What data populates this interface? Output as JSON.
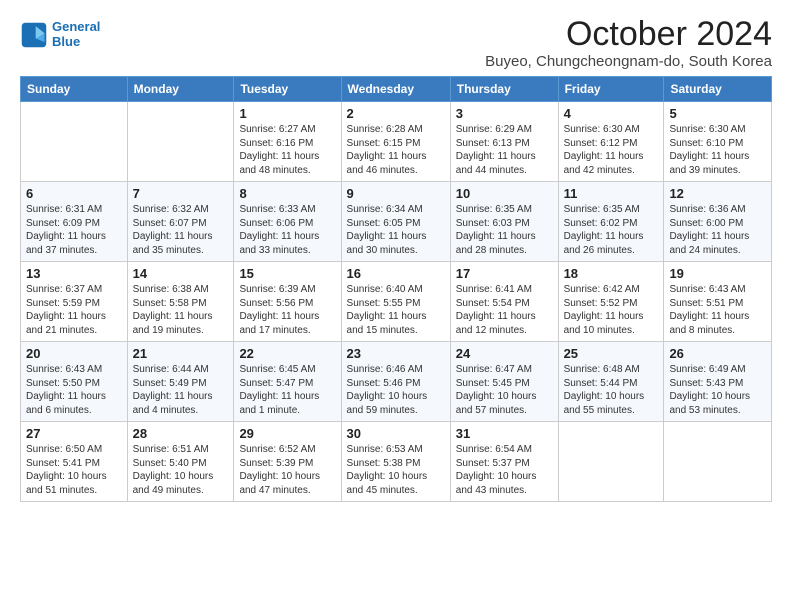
{
  "header": {
    "logo_line1": "General",
    "logo_line2": "Blue",
    "month_title": "October 2024",
    "location": "Buyeo, Chungcheongnam-do, South Korea"
  },
  "weekdays": [
    "Sunday",
    "Monday",
    "Tuesday",
    "Wednesday",
    "Thursday",
    "Friday",
    "Saturday"
  ],
  "weeks": [
    [
      {
        "day": "",
        "sunrise": "",
        "sunset": "",
        "daylight": ""
      },
      {
        "day": "",
        "sunrise": "",
        "sunset": "",
        "daylight": ""
      },
      {
        "day": "1",
        "sunrise": "Sunrise: 6:27 AM",
        "sunset": "Sunset: 6:16 PM",
        "daylight": "Daylight: 11 hours and 48 minutes."
      },
      {
        "day": "2",
        "sunrise": "Sunrise: 6:28 AM",
        "sunset": "Sunset: 6:15 PM",
        "daylight": "Daylight: 11 hours and 46 minutes."
      },
      {
        "day": "3",
        "sunrise": "Sunrise: 6:29 AM",
        "sunset": "Sunset: 6:13 PM",
        "daylight": "Daylight: 11 hours and 44 minutes."
      },
      {
        "day": "4",
        "sunrise": "Sunrise: 6:30 AM",
        "sunset": "Sunset: 6:12 PM",
        "daylight": "Daylight: 11 hours and 42 minutes."
      },
      {
        "day": "5",
        "sunrise": "Sunrise: 6:30 AM",
        "sunset": "Sunset: 6:10 PM",
        "daylight": "Daylight: 11 hours and 39 minutes."
      }
    ],
    [
      {
        "day": "6",
        "sunrise": "Sunrise: 6:31 AM",
        "sunset": "Sunset: 6:09 PM",
        "daylight": "Daylight: 11 hours and 37 minutes."
      },
      {
        "day": "7",
        "sunrise": "Sunrise: 6:32 AM",
        "sunset": "Sunset: 6:07 PM",
        "daylight": "Daylight: 11 hours and 35 minutes."
      },
      {
        "day": "8",
        "sunrise": "Sunrise: 6:33 AM",
        "sunset": "Sunset: 6:06 PM",
        "daylight": "Daylight: 11 hours and 33 minutes."
      },
      {
        "day": "9",
        "sunrise": "Sunrise: 6:34 AM",
        "sunset": "Sunset: 6:05 PM",
        "daylight": "Daylight: 11 hours and 30 minutes."
      },
      {
        "day": "10",
        "sunrise": "Sunrise: 6:35 AM",
        "sunset": "Sunset: 6:03 PM",
        "daylight": "Daylight: 11 hours and 28 minutes."
      },
      {
        "day": "11",
        "sunrise": "Sunrise: 6:35 AM",
        "sunset": "Sunset: 6:02 PM",
        "daylight": "Daylight: 11 hours and 26 minutes."
      },
      {
        "day": "12",
        "sunrise": "Sunrise: 6:36 AM",
        "sunset": "Sunset: 6:00 PM",
        "daylight": "Daylight: 11 hours and 24 minutes."
      }
    ],
    [
      {
        "day": "13",
        "sunrise": "Sunrise: 6:37 AM",
        "sunset": "Sunset: 5:59 PM",
        "daylight": "Daylight: 11 hours and 21 minutes."
      },
      {
        "day": "14",
        "sunrise": "Sunrise: 6:38 AM",
        "sunset": "Sunset: 5:58 PM",
        "daylight": "Daylight: 11 hours and 19 minutes."
      },
      {
        "day": "15",
        "sunrise": "Sunrise: 6:39 AM",
        "sunset": "Sunset: 5:56 PM",
        "daylight": "Daylight: 11 hours and 17 minutes."
      },
      {
        "day": "16",
        "sunrise": "Sunrise: 6:40 AM",
        "sunset": "Sunset: 5:55 PM",
        "daylight": "Daylight: 11 hours and 15 minutes."
      },
      {
        "day": "17",
        "sunrise": "Sunrise: 6:41 AM",
        "sunset": "Sunset: 5:54 PM",
        "daylight": "Daylight: 11 hours and 12 minutes."
      },
      {
        "day": "18",
        "sunrise": "Sunrise: 6:42 AM",
        "sunset": "Sunset: 5:52 PM",
        "daylight": "Daylight: 11 hours and 10 minutes."
      },
      {
        "day": "19",
        "sunrise": "Sunrise: 6:43 AM",
        "sunset": "Sunset: 5:51 PM",
        "daylight": "Daylight: 11 hours and 8 minutes."
      }
    ],
    [
      {
        "day": "20",
        "sunrise": "Sunrise: 6:43 AM",
        "sunset": "Sunset: 5:50 PM",
        "daylight": "Daylight: 11 hours and 6 minutes."
      },
      {
        "day": "21",
        "sunrise": "Sunrise: 6:44 AM",
        "sunset": "Sunset: 5:49 PM",
        "daylight": "Daylight: 11 hours and 4 minutes."
      },
      {
        "day": "22",
        "sunrise": "Sunrise: 6:45 AM",
        "sunset": "Sunset: 5:47 PM",
        "daylight": "Daylight: 11 hours and 1 minute."
      },
      {
        "day": "23",
        "sunrise": "Sunrise: 6:46 AM",
        "sunset": "Sunset: 5:46 PM",
        "daylight": "Daylight: 10 hours and 59 minutes."
      },
      {
        "day": "24",
        "sunrise": "Sunrise: 6:47 AM",
        "sunset": "Sunset: 5:45 PM",
        "daylight": "Daylight: 10 hours and 57 minutes."
      },
      {
        "day": "25",
        "sunrise": "Sunrise: 6:48 AM",
        "sunset": "Sunset: 5:44 PM",
        "daylight": "Daylight: 10 hours and 55 minutes."
      },
      {
        "day": "26",
        "sunrise": "Sunrise: 6:49 AM",
        "sunset": "Sunset: 5:43 PM",
        "daylight": "Daylight: 10 hours and 53 minutes."
      }
    ],
    [
      {
        "day": "27",
        "sunrise": "Sunrise: 6:50 AM",
        "sunset": "Sunset: 5:41 PM",
        "daylight": "Daylight: 10 hours and 51 minutes."
      },
      {
        "day": "28",
        "sunrise": "Sunrise: 6:51 AM",
        "sunset": "Sunset: 5:40 PM",
        "daylight": "Daylight: 10 hours and 49 minutes."
      },
      {
        "day": "29",
        "sunrise": "Sunrise: 6:52 AM",
        "sunset": "Sunset: 5:39 PM",
        "daylight": "Daylight: 10 hours and 47 minutes."
      },
      {
        "day": "30",
        "sunrise": "Sunrise: 6:53 AM",
        "sunset": "Sunset: 5:38 PM",
        "daylight": "Daylight: 10 hours and 45 minutes."
      },
      {
        "day": "31",
        "sunrise": "Sunrise: 6:54 AM",
        "sunset": "Sunset: 5:37 PM",
        "daylight": "Daylight: 10 hours and 43 minutes."
      },
      {
        "day": "",
        "sunrise": "",
        "sunset": "",
        "daylight": ""
      },
      {
        "day": "",
        "sunrise": "",
        "sunset": "",
        "daylight": ""
      }
    ]
  ]
}
